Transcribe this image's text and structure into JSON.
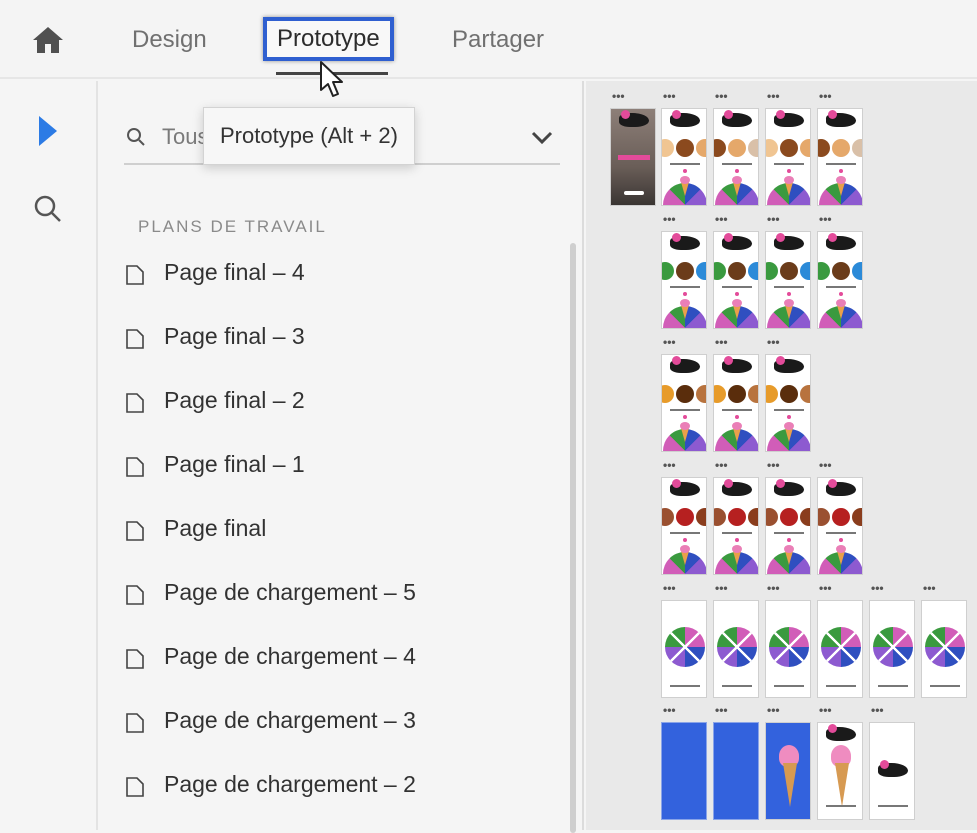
{
  "topbar": {
    "tabs": [
      {
        "label": "Design",
        "active": false
      },
      {
        "label": "Prototype",
        "active": true
      },
      {
        "label": "Partager",
        "active": false
      }
    ],
    "home_icon": "home-icon",
    "cursor_icon": "mouse-pointer-icon"
  },
  "rail": {
    "items": [
      {
        "icon": "select-arrow-icon",
        "active": true,
        "color": "#2c7be5"
      },
      {
        "icon": "search-icon",
        "active": false
      }
    ]
  },
  "panel": {
    "search_value": "Tous",
    "tooltip": "Prototype (Alt + 2)",
    "section_title": "PLANS DE TRAVAIL",
    "artboards": [
      "Page final – 4",
      "Page final – 3",
      "Page final – 2",
      "Page final – 1",
      "Page final",
      "Page de chargement – 5",
      "Page de chargement – 4",
      "Page de chargement – 3",
      "Page de chargement – 2"
    ]
  },
  "canvas": {
    "dots": "•••",
    "colors": {
      "accent": "#2f5fd0",
      "pink": "#e34b9a",
      "blue": "#3362dd",
      "green": "#3a9a3f",
      "purple": "#8d5ad0"
    }
  }
}
